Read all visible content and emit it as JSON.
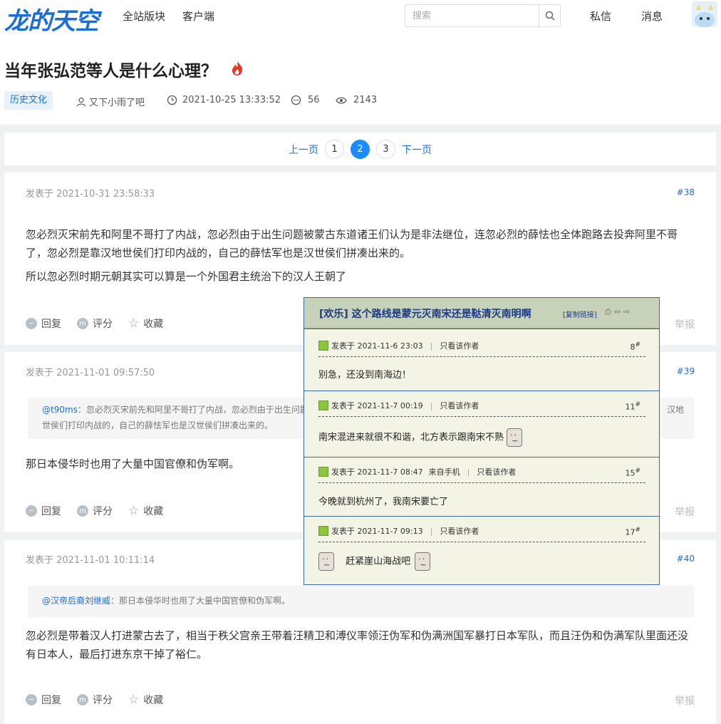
{
  "nav": {
    "logo": "龙的天空",
    "links": [
      "全站版块",
      "客户端"
    ],
    "search_placeholder": "搜索",
    "messages": "私信",
    "notifications": "消息"
  },
  "thread": {
    "title": "当年张弘范等人是什么心理？",
    "tag": "历史文化",
    "author": "又下小雨了吧",
    "datetime": "2021-10-25 13:33:52",
    "replies": "56",
    "views": "2143"
  },
  "pager": {
    "prev": "上一页",
    "pages": [
      "1",
      "2",
      "3"
    ],
    "current": "2",
    "next": "下一页"
  },
  "actions": {
    "reply": "回复",
    "rate": "评分",
    "favorite": "收藏",
    "report": "举报"
  },
  "posts": [
    {
      "posted": "发表于 2021-10-31 23:58:33",
      "floor": "#38",
      "paragraphs": [
        "忽必烈灭宋前先和阿里不哥打了内战，忽必烈由于出生问题被蒙古东道诸王们认为是非法继位，连忽必烈的薛怯也全体跑路去投奔阿里不哥了，忽必烈是靠汉地世侯们打印内战的，自己的薛怯军也是汉世侯们拼凑出来的。",
        "所以忽必烈时期元朝其实可以算是一个外国君主统治下的汉人王朝了"
      ]
    },
    {
      "posted": "发表于 2021-11-01 09:57:50",
      "floor": "#39",
      "quote_user": "@t90ms",
      "quote_text_1": "：忽必烈灭宋前先和阿里不哥打了内战，忽必烈由于出生问题",
      "quote_text_tail": "汉地",
      "quote_text_2": "世侯们打印内战的，自己的薛怯军也是汉世侯们拼凑出来的。",
      "paragraphs": [
        "那日本侵华时也用了大量中国官僚和伪军啊。"
      ]
    },
    {
      "posted": "发表于 2021-11-01 10:11:14",
      "floor": "#40",
      "quote_user": "@汉帝后裔刘继威",
      "quote_text_1": "：那日本侵华时也用了大量中国官僚和伪军啊。",
      "paragraphs": [
        "忽必烈是带着汉人打进蒙古去了，相当于秩父宫亲王带着汪精卫和溥仪率领汪伪军和伪满洲国军暴打日本军队，而且汪伪和伪满军队里面还没有日本人，最后打进东京干掉了裕仁。"
      ]
    }
  ],
  "popup": {
    "title": "[欢乐] 这个路线是蒙元灭南宋还是鞑清灭南明啊",
    "copy_link": "[复制链接]",
    "only_author": "只看该作者",
    "entries": [
      {
        "posted": "发表于 2021-11-6 23:03",
        "from": "",
        "num": "8",
        "text": "别急，还没到南海边！"
      },
      {
        "posted": "发表于 2021-11-7 00:19",
        "from": "",
        "num": "11",
        "text": "南宋混进来就很不和谐，北方表示跟南宋不熟"
      },
      {
        "posted": "发表于 2021-11-7 08:47",
        "from": "来自手机",
        "num": "15",
        "text": "今晚就到杭州了，我南宋要亡了"
      },
      {
        "posted": "发表于 2021-11-7 09:13",
        "from": "",
        "num": "17",
        "text": "赶紧崖山海战吧"
      }
    ],
    "hash": "#"
  },
  "colors": {
    "link": "#1a6ed8",
    "active_page": "#1a8cff",
    "popup_bg": "#f3f4e6",
    "popup_border": "#3a6aa8"
  }
}
